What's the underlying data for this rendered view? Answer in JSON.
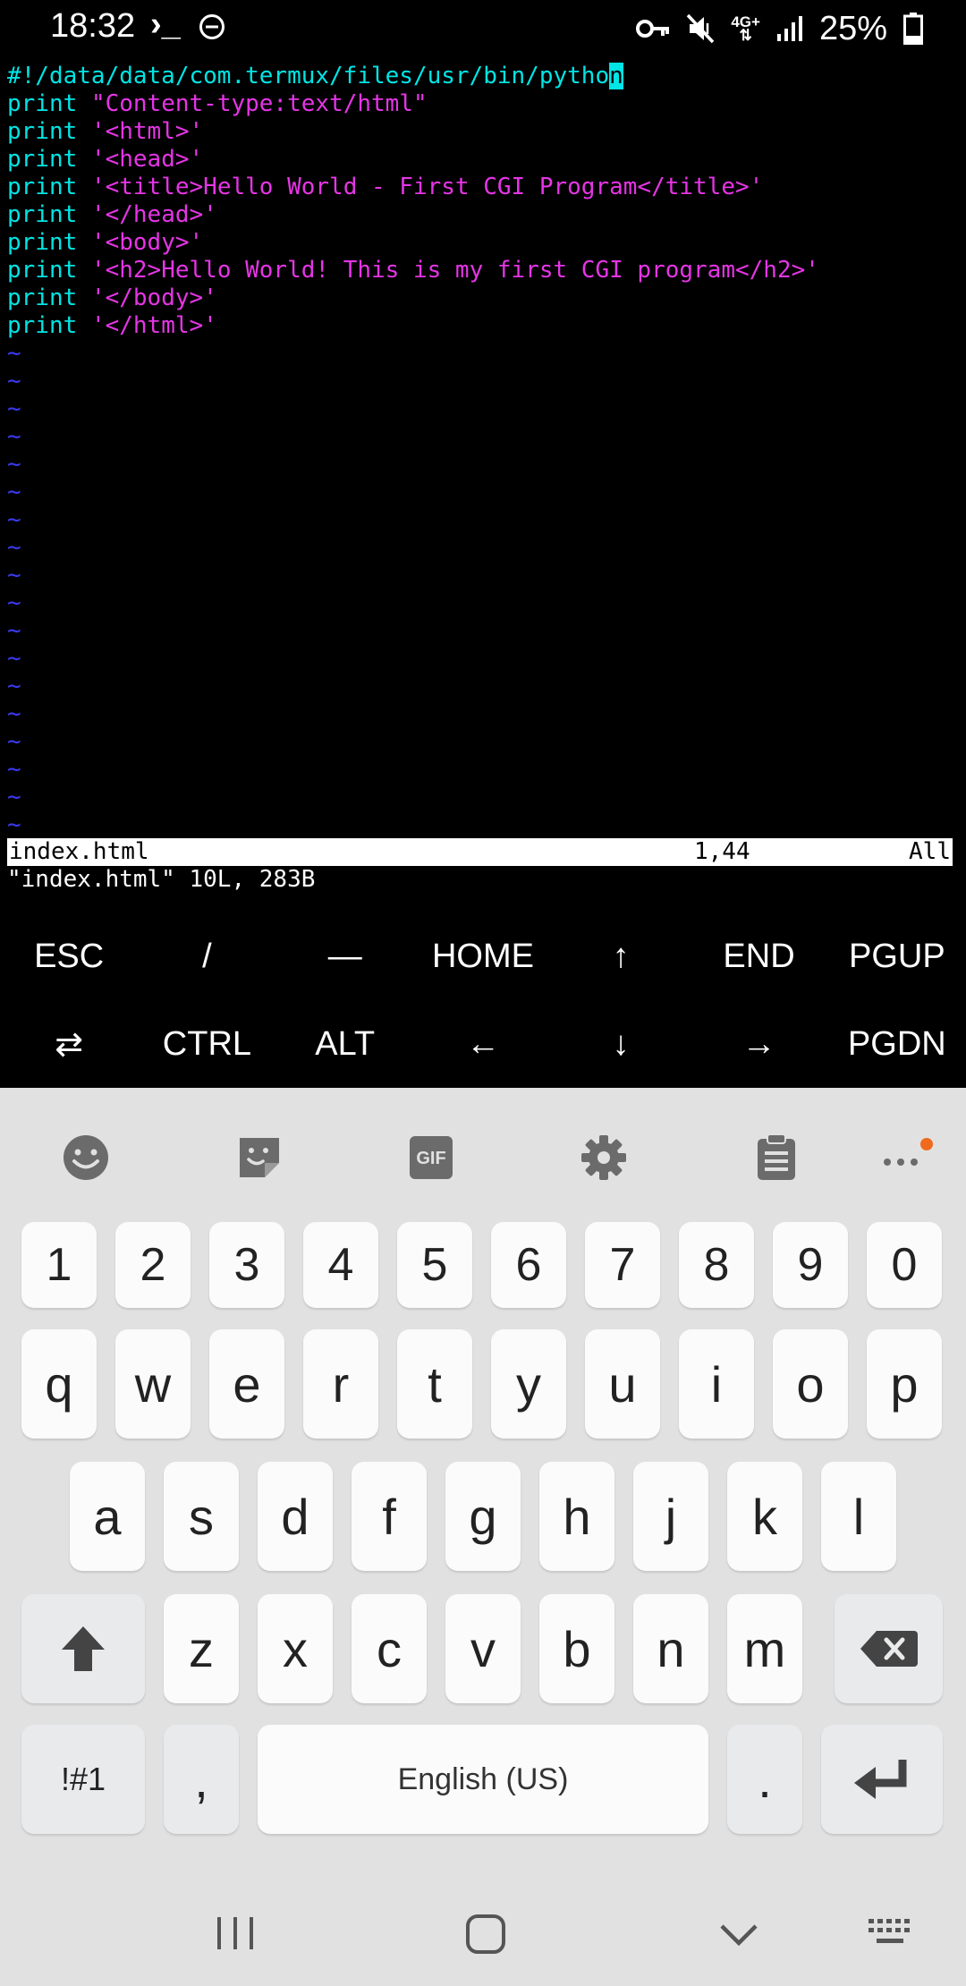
{
  "status_bar": {
    "time": "18:32",
    "terminal_glyph": "›_",
    "network_type": "4G+",
    "battery": "25%",
    "icons": [
      "terminal-icon",
      "dnd-icon",
      "vpn-key-icon",
      "mute-icon",
      "signal-icon",
      "battery-icon"
    ]
  },
  "editor": {
    "lines": [
      [
        {
          "t": "#!/data/data/com.termux/files/usr/bin/pytho",
          "c": "kw"
        },
        {
          "t": "n",
          "c": "cursor"
        }
      ],
      [
        {
          "t": "print",
          "c": "kw"
        },
        {
          "t": " ",
          "c": ""
        },
        {
          "t": "\"Content-type:text/html\"",
          "c": "str"
        }
      ],
      [
        {
          "t": "print",
          "c": "kw"
        },
        {
          "t": " ",
          "c": ""
        },
        {
          "t": "'<html>'",
          "c": "str"
        }
      ],
      [
        {
          "t": "print",
          "c": "kw"
        },
        {
          "t": " ",
          "c": ""
        },
        {
          "t": "'<head>'",
          "c": "str"
        }
      ],
      [
        {
          "t": "print",
          "c": "kw"
        },
        {
          "t": " ",
          "c": ""
        },
        {
          "t": "'<title>Hello World - First CGI Program</title>'",
          "c": "str"
        }
      ],
      [
        {
          "t": "print",
          "c": "kw"
        },
        {
          "t": " ",
          "c": ""
        },
        {
          "t": "'</head>'",
          "c": "str"
        }
      ],
      [
        {
          "t": "print",
          "c": "kw"
        },
        {
          "t": " ",
          "c": ""
        },
        {
          "t": "'<body>'",
          "c": "str"
        }
      ],
      [
        {
          "t": "print",
          "c": "kw"
        },
        {
          "t": " ",
          "c": ""
        },
        {
          "t": "'<h2>Hello World! This is my first CGI program</h2>'",
          "c": "str"
        }
      ],
      [
        {
          "t": "print",
          "c": "kw"
        },
        {
          "t": " ",
          "c": ""
        },
        {
          "t": "'</body>'",
          "c": "str"
        }
      ],
      [
        {
          "t": "print",
          "c": "kw"
        },
        {
          "t": " ",
          "c": ""
        },
        {
          "t": "'</html>'",
          "c": "str"
        }
      ]
    ],
    "empty_line_marker": "~",
    "empty_lines": 18,
    "status_line": {
      "filename": "index.html",
      "position": "1,44",
      "scroll": "All"
    },
    "message": "\"index.html\" 10L, 283B",
    "colors": {
      "keyword": "#00e5e5",
      "string": "#e535e5",
      "tilde": "#3a3af0"
    }
  },
  "extra_keys": {
    "row1": [
      "ESC",
      "/",
      "—",
      "HOME",
      "↑",
      "END",
      "PGUP"
    ],
    "row2": [
      "⇄",
      "CTRL",
      "ALT",
      "←",
      "↓",
      "→",
      "PGDN"
    ]
  },
  "keyboard": {
    "toolbar_icons": [
      "emoji-icon",
      "sticker-icon",
      "gif-icon",
      "settings-icon",
      "clipboard-icon",
      "more-icon"
    ],
    "gif_label": "GIF",
    "numbers": [
      "1",
      "2",
      "3",
      "4",
      "5",
      "6",
      "7",
      "8",
      "9",
      "0"
    ],
    "row1": [
      "q",
      "w",
      "e",
      "r",
      "t",
      "y",
      "u",
      "i",
      "o",
      "p"
    ],
    "row2": [
      "a",
      "s",
      "d",
      "f",
      "g",
      "h",
      "j",
      "k",
      "l"
    ],
    "row3": [
      "z",
      "x",
      "c",
      "v",
      "b",
      "n",
      "m"
    ],
    "symbols_label": "!#1",
    "comma": ",",
    "space_label": "English (US)",
    "period": ".",
    "accent_dot_color": "#f06a1e"
  },
  "nav_bar": {
    "icons": [
      "recents-icon",
      "home-icon",
      "back-icon",
      "keyboard-switch-icon"
    ]
  }
}
